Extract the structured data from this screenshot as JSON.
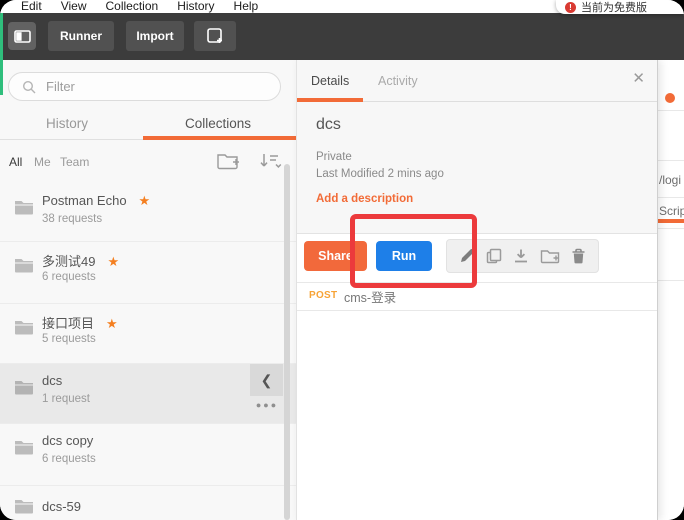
{
  "menu": {
    "items": [
      "Edit",
      "View",
      "Collection",
      "History",
      "Help"
    ]
  },
  "notification": {
    "text": "当前为免费版"
  },
  "toolbar": {
    "runner_label": "Runner",
    "import_label": "Import"
  },
  "sidebar": {
    "filter_placeholder": "Filter",
    "tab_history": "History",
    "tab_collections": "Collections",
    "scope_all": "All",
    "scope_me": "Me",
    "scope_team": "Team",
    "collections": [
      {
        "name": "Postman Echo",
        "count": "38 requests"
      },
      {
        "name": "多测试49",
        "count": "6 requests"
      },
      {
        "name": "接口项目",
        "count": "5 requests"
      },
      {
        "name": "dcs",
        "count": "1 request"
      },
      {
        "name": "dcs copy",
        "count": "6 requests"
      },
      {
        "name": "dcs-59",
        "count": ""
      }
    ]
  },
  "details": {
    "tab_details": "Details",
    "tab_activity": "Activity",
    "title": "dcs",
    "visibility": "Private",
    "last_modified": "Last Modified 2 mins ago",
    "add_description_label": "Add a description",
    "share_label": "Share",
    "run_label": "Run",
    "request_method": "POST",
    "request_name": "cms-登录"
  },
  "background_window": {
    "url_fragment": "/logi",
    "tab_fragment": "Scrip"
  },
  "colors": {
    "accent_orange": "#F26B37",
    "share_orange": "#F2693B",
    "run_blue": "#1E7FE8",
    "annotation_red": "#EC3A3C",
    "star_orange": "#F47F20",
    "method_post_orange": "#F7A336",
    "toolbar_gray": "#3C3C3C",
    "green_edge": "#2FBE7C"
  }
}
